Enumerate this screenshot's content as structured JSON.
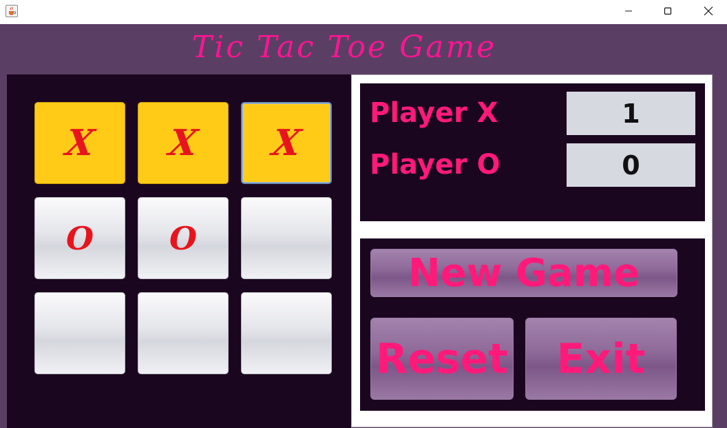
{
  "window": {
    "icons": {
      "app": "java-cup-icon",
      "minimize": "minimize-icon",
      "maximize": "maximize-icon",
      "close": "close-icon"
    }
  },
  "game": {
    "title": "Tic Tac Toe Game",
    "board": {
      "cells": [
        "X",
        "X",
        "X",
        "O",
        "O",
        "",
        "",
        "",
        ""
      ],
      "winning_cells": [
        0,
        1,
        2
      ],
      "focused_cell": 2
    }
  },
  "scores": {
    "player_x_label": "Player X",
    "player_x_score": "1",
    "player_o_label": "Player O",
    "player_o_score": "0"
  },
  "controls": {
    "new_game_label": "New Game",
    "reset_label": "Reset",
    "exit_label": "Exit"
  },
  "colors": {
    "accent": "#ff1a7a",
    "mark": "#e8141c",
    "win_cell": "#ffcb17",
    "frame_bg": "#5b3e64",
    "panel_bg": "#1b0620"
  }
}
